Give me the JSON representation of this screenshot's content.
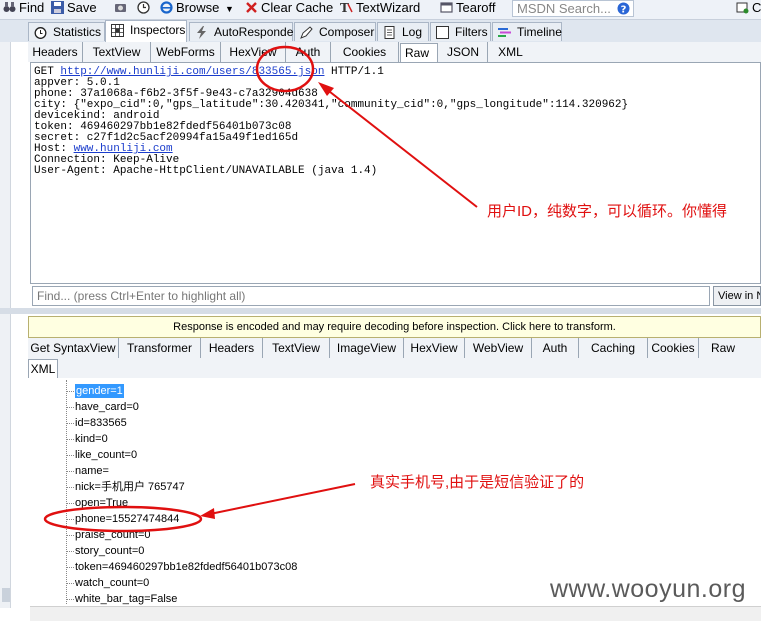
{
  "toolbar": {
    "find": "Find",
    "save": "Save",
    "browse": "Browse",
    "clear_cache": "Clear Cache",
    "textwizard": "TextWizard",
    "tearoff": "Tearoff",
    "msdn_placeholder": "MSDN Search...",
    "right_partial": "C"
  },
  "main_tabs": [
    "Statistics",
    "Inspectors",
    "AutoResponder",
    "Composer",
    "Log",
    "Filters",
    "Timeline"
  ],
  "request_tabs": [
    "Headers",
    "TextView",
    "WebForms",
    "HexView",
    "Auth",
    "Cookies",
    "Raw",
    "JSON",
    "XML"
  ],
  "request": {
    "line1_pre": "GET ",
    "url": "http://www.hunliji.com/users/833565.json",
    "line1_post": " HTTP/1.1",
    "lines": [
      "appver: 5.0.1",
      "phone: 37a1068a-f6b2-3f5f-9e43-c7a32904d638",
      "city: {\"expo_cid\":0,\"gps_latitude\":30.420341,\"community_cid\":0,\"gps_longitude\":114.320962}",
      "devicekind: android",
      "token: 469460297bb1e82fdedf56401b073c08",
      "secret: c27f1d2c5acf20994fa15a49f1ed165d"
    ],
    "host_pre": "Host: ",
    "host": "www.hunliji.com",
    "lines2": [
      "Connection: Keep-Alive",
      "User-Agent: Apache-HttpClient/UNAVAILABLE (java 1.4)"
    ]
  },
  "find_placeholder": "Find... (press Ctrl+Enter to highlight all)",
  "view_in": "View in N",
  "response_banner": "Response is encoded and may require decoding before inspection. Click here to transform.",
  "response_tabs": [
    "Get SyntaxView",
    "Transformer",
    "Headers",
    "TextView",
    "ImageView",
    "HexView",
    "WebView",
    "Auth",
    "Caching",
    "Cookies",
    "Raw"
  ],
  "response_tab_xml": "XML",
  "tree": [
    "gender=1",
    "have_card=0",
    "id=833565",
    "kind=0",
    "like_count=0",
    "name=",
    "nick=手机用户 765747",
    "open=True",
    "phone=15527474844",
    "praise_count=0",
    "story_count=0",
    "token=469460297bb1e82fdedf56401b073c08",
    "watch_count=0",
    "white_bar_tag=False"
  ],
  "annotations": {
    "user_id_note": "用户ID，纯数字，可以循环。你懂得",
    "phone_note": "真实手机号,由于是短信验证了的",
    "color": "#e01010"
  },
  "watermark": "www.wooyun.org"
}
